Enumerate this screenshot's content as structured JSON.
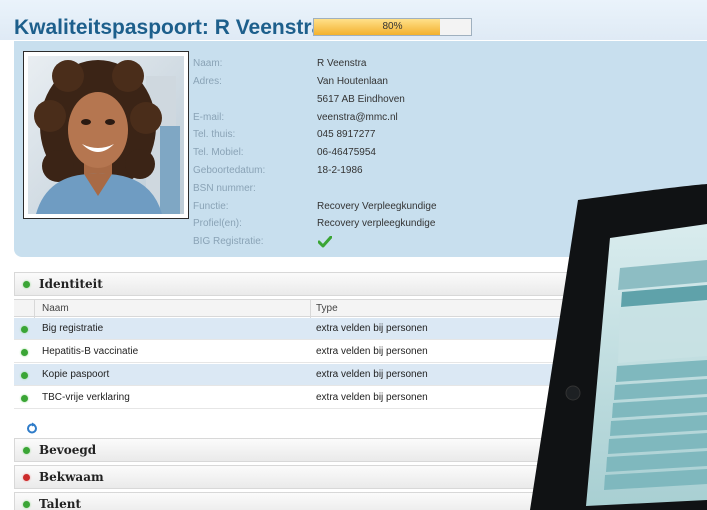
{
  "header": {
    "title": "Kwaliteitspaspoort: R Veenstra",
    "progress_label": "80%",
    "progress_fraction": 0.8
  },
  "profile": {
    "fields": [
      {
        "label": "Naam:",
        "value": "R Veenstra"
      },
      {
        "label": "Adres:",
        "value": "Van Houtenlaan"
      },
      {
        "label": "",
        "value": "5617 AB Eindhoven"
      },
      {
        "label": "E-mail:",
        "value": "veenstra@mmc.nl"
      },
      {
        "label": "Tel. thuis:",
        "value": "045 8917277"
      },
      {
        "label": "Tel. Mobiel:",
        "value": "06-46475954"
      },
      {
        "label": "Geboortedatum:",
        "value": "18-2-1986"
      },
      {
        "label": "BSN nummer:",
        "value": ""
      },
      {
        "label": "Functie:",
        "value": "Recovery Verpleegkundige"
      },
      {
        "label": "Profiel(en):",
        "value": "Recovery verpleegkundige"
      },
      {
        "label": "BIG Registratie:",
        "value": ""
      }
    ],
    "big_registered_icon": "check-icon"
  },
  "sections": {
    "identiteit": {
      "title": "Identiteit",
      "status": "green"
    },
    "bevoegd": {
      "title": "Bevoegd",
      "status": "green"
    },
    "bekwaam": {
      "title": "Bekwaam",
      "status": "red"
    },
    "talent": {
      "title": "Talent",
      "status": "green"
    }
  },
  "table": {
    "columns": [
      "Naam",
      "Type"
    ],
    "rows": [
      {
        "naam": "Big registratie",
        "type": "extra velden bij personen",
        "status": "green"
      },
      {
        "naam": "Hepatitis-B vaccinatie",
        "type": "extra velden bij personen",
        "status": "green"
      },
      {
        "naam": "Kopie paspoort",
        "type": "extra velden bij personen",
        "status": "green"
      },
      {
        "naam": "TBC-vrije verklaring",
        "type": "extra velden bij personen",
        "status": "green"
      }
    ]
  },
  "colors": {
    "title": "#1d5f8c",
    "profile_bg": "#c8dfee",
    "status_green": "#3aa535",
    "status_red": "#cc2b2b",
    "progress_fill": "#f3b12e"
  }
}
